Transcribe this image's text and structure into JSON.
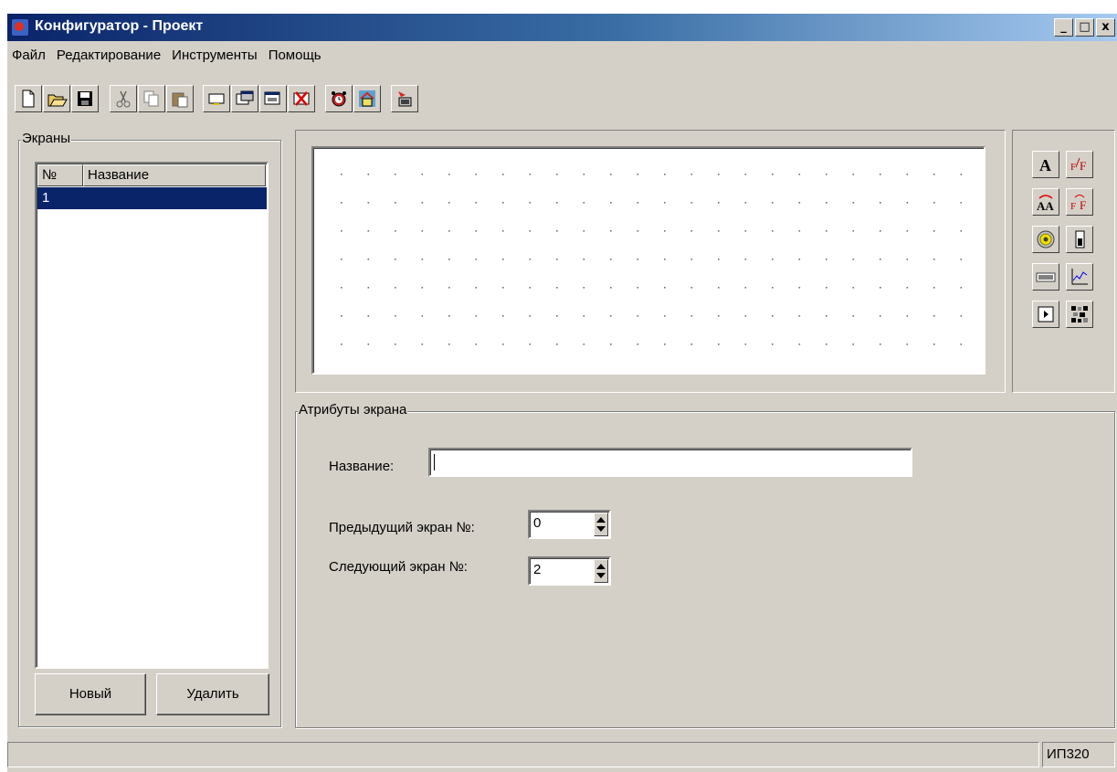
{
  "window": {
    "title": "Конфигуратор - Проект",
    "controls": {
      "minimize": "_",
      "maximize": "□",
      "close": "x"
    }
  },
  "menu": {
    "items": [
      {
        "label": "Файл"
      },
      {
        "label": "Редактирование"
      },
      {
        "label": "Инструменты"
      },
      {
        "label": "Помощь"
      }
    ]
  },
  "toolbar": {
    "buttons": [
      {
        "icon": "new-file-icon"
      },
      {
        "icon": "open-folder-icon"
      },
      {
        "icon": "save-icon"
      },
      {
        "icon": "cut-icon"
      },
      {
        "icon": "copy-icon"
      },
      {
        "icon": "paste-icon"
      },
      {
        "icon": "add-screen-icon"
      },
      {
        "icon": "screen-properties-icon"
      },
      {
        "icon": "screen-list-icon"
      },
      {
        "icon": "delete-screen-icon"
      },
      {
        "icon": "alarm-clock-icon"
      },
      {
        "icon": "home-screen-icon"
      },
      {
        "icon": "upload-to-device-icon"
      }
    ]
  },
  "screens_panel": {
    "title": "Экраны",
    "columns": [
      "№",
      "Название"
    ],
    "rows": [
      {
        "number": "1",
        "name": ""
      }
    ],
    "new_button": "Новый",
    "delete_button": "Удалить"
  },
  "elements_panel": {
    "tools": [
      {
        "icon": "text-icon"
      },
      {
        "icon": "formatted-text-icon"
      },
      {
        "icon": "variable-text-icon"
      },
      {
        "icon": "variable-formatted-text-icon"
      },
      {
        "icon": "indicator-lamp-icon"
      },
      {
        "icon": "level-bar-icon"
      },
      {
        "icon": "numeric-display-icon"
      },
      {
        "icon": "trend-graph-icon"
      },
      {
        "icon": "action-button-icon"
      },
      {
        "icon": "bitmap-image-icon"
      }
    ]
  },
  "attributes": {
    "title": "Атрибуты экрана",
    "name_label": "Название:",
    "name_value": "",
    "prev_label": "Предыдущий экран №:",
    "prev_value": "0",
    "next_label": "Следующий экран №:",
    "next_value": "2"
  },
  "statusbar": {
    "device": "ИП320"
  }
}
